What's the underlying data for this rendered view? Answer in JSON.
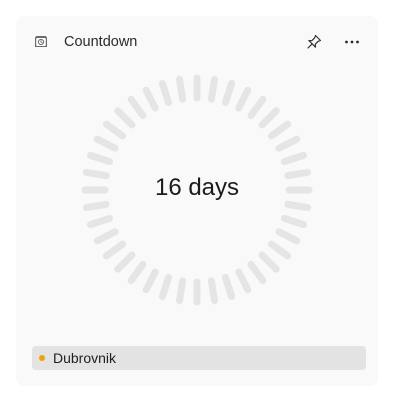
{
  "widget": {
    "title": "Countdown",
    "icon": "countdown-clock-icon",
    "pin_icon": "pin-icon",
    "more_icon": "more-options-icon"
  },
  "countdown": {
    "display": "16 days",
    "ring_color": "#e5e5e5"
  },
  "event": {
    "name": "Dubrovnik",
    "dot_color": "#f0a30a"
  }
}
